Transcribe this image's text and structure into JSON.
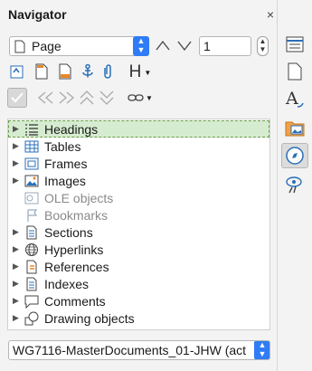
{
  "header": {
    "title": "Navigator",
    "close_glyph": "×",
    "menu_glyph": "⋮"
  },
  "toolbar": {
    "navigate_by": "Page",
    "page_number": "1",
    "heading_glyph": "H"
  },
  "tree": {
    "items": [
      {
        "label": "Headings",
        "icon": "headings-icon",
        "enabled": true
      },
      {
        "label": "Tables",
        "icon": "table-icon",
        "enabled": true
      },
      {
        "label": "Frames",
        "icon": "frame-icon",
        "enabled": true
      },
      {
        "label": "Images",
        "icon": "image-icon",
        "enabled": true
      },
      {
        "label": "OLE objects",
        "icon": "ole-icon",
        "enabled": false
      },
      {
        "label": "Bookmarks",
        "icon": "bookmark-icon",
        "enabled": false
      },
      {
        "label": "Sections",
        "icon": "section-icon",
        "enabled": true
      },
      {
        "label": "Hyperlinks",
        "icon": "globe-icon",
        "enabled": true
      },
      {
        "label": "References",
        "icon": "reference-icon",
        "enabled": true
      },
      {
        "label": "Indexes",
        "icon": "index-icon",
        "enabled": true
      },
      {
        "label": "Comments",
        "icon": "comment-icon",
        "enabled": true
      },
      {
        "label": "Drawing objects",
        "icon": "drawing-icon",
        "enabled": true
      }
    ]
  },
  "document_select": {
    "value": "WG7116-MasterDocuments_01-JHW (act"
  },
  "colors": {
    "accent": "#2f7cf6",
    "selection": "#d6ecd0",
    "icon_orange": "#e8862a",
    "icon_blue": "#2a6fb8"
  }
}
